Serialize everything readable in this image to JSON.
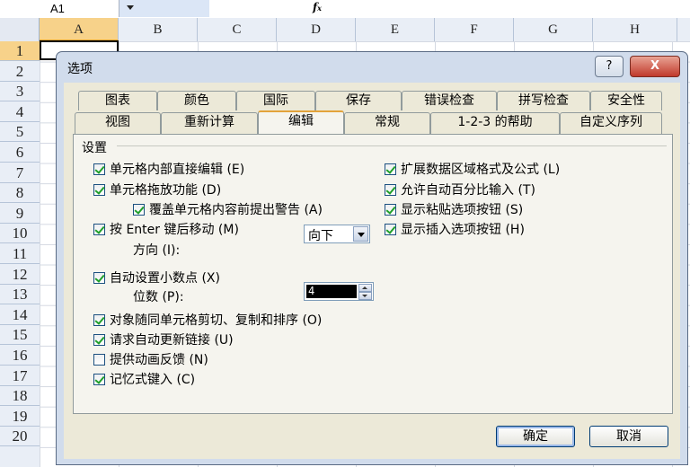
{
  "formula_bar": {
    "name_box": "A1",
    "fx": "f",
    "fx_sub": "x"
  },
  "columns": [
    {
      "label": "A",
      "selected": true
    },
    {
      "label": "B"
    },
    {
      "label": "C"
    },
    {
      "label": "D"
    },
    {
      "label": "E"
    },
    {
      "label": "F"
    },
    {
      "label": "G"
    },
    {
      "label": "H"
    }
  ],
  "rows": [
    "1",
    "2",
    "3",
    "4",
    "5",
    "6",
    "7",
    "8",
    "9",
    "10",
    "11",
    "12",
    "13",
    "14",
    "15",
    "16",
    "17",
    "18",
    "19",
    "20"
  ],
  "dialog": {
    "title": "选项",
    "help_label": "?",
    "close_label": "X",
    "tabs_row1": [
      "图表",
      "颜色",
      "国际",
      "保存",
      "错误检查",
      "拼写检查",
      "安全性"
    ],
    "tabs_row2": [
      "视图",
      "重新计算",
      "编辑",
      "常规",
      "1-2-3 的帮助",
      "自定义序列"
    ],
    "active_tab": "编辑",
    "settings_label": "设置",
    "left_options": [
      {
        "label": "单元格内部直接编辑 (E)",
        "checked": true
      },
      {
        "label": "单元格拖放功能 (D)",
        "checked": true
      },
      {
        "label": "覆盖单元格内容前提出警告 (A)",
        "checked": true
      },
      {
        "label": "按 Enter 键后移动 (M)",
        "checked": true
      },
      {
        "label": "自动设置小数点 (X)",
        "checked": true
      },
      {
        "label": "对象随同单元格剪切、复制和排序 (O)",
        "checked": true
      },
      {
        "label": "请求自动更新链接 (U)",
        "checked": true
      },
      {
        "label": "提供动画反馈 (N)",
        "checked": false
      },
      {
        "label": "记忆式键入 (C)",
        "checked": true
      }
    ],
    "direction_label": "方向 (I):",
    "direction_value": "向下",
    "decimals_label": "位数 (P):",
    "decimals_value": "4",
    "right_options": [
      {
        "label": "扩展数据区域格式及公式 (L)",
        "checked": true
      },
      {
        "label": "允许自动百分比输入 (T)",
        "checked": true
      },
      {
        "label": "显示粘贴选项按钮 (S)",
        "checked": true
      },
      {
        "label": "显示插入选项按钮 (H)",
        "checked": true
      }
    ],
    "ok_label": "确定",
    "cancel_label": "取消"
  }
}
